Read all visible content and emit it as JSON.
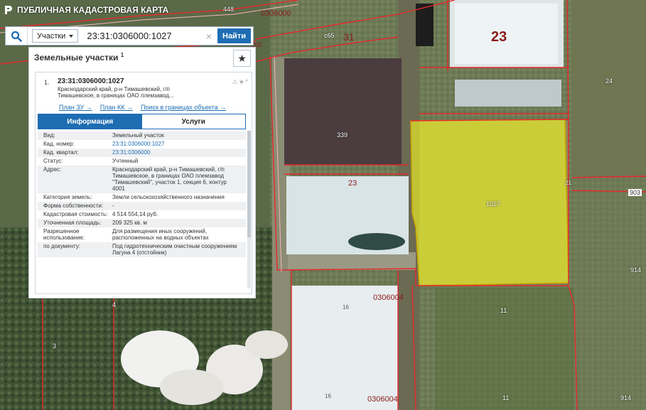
{
  "app": {
    "title": "ПУБЛИЧНАЯ КАДАСТРОВАЯ КАРТА"
  },
  "search": {
    "type_label": "Участки",
    "value": "23:31:0306000:1027",
    "submit_label": "Найти"
  },
  "panel": {
    "title": "Земельные участки",
    "count": "1",
    "item": {
      "index": "1.",
      "cad_number": "23:31:0306000:1027",
      "address_short": "Краснодарский край, р-н Тимашевский, г/п Тимашевское, в границах ОАО племзавод...",
      "links": [
        "План ЗУ →",
        "План КК →",
        "Поиск в границах объекта →"
      ],
      "tabs": [
        "Информация",
        "Услуги"
      ],
      "rows": [
        {
          "k": "Вид:",
          "v": "Земельный участок"
        },
        {
          "k": "Кад. номер:",
          "v": "23:31:0306000:1027"
        },
        {
          "k": "Кад. квартал:",
          "v": "23:31:0306000"
        },
        {
          "k": "Статус:",
          "v": "Учтенный"
        },
        {
          "k": "Адрес:",
          "v": "Краснодарский край, р-н Тимашевский, г/п Тимашевское, в границах ОАО племзавод \"Тимашевский\", участок 1, секция 6, контур 4001"
        },
        {
          "k": "Категория земель:",
          "v": "Земли сельскохозяйственного назначения"
        },
        {
          "k": "Форма собственности:",
          "v": "-"
        },
        {
          "k": "Кадастровая стоимость:",
          "v": "4 514 554,14 руб."
        },
        {
          "k": "Уточненная площадь:",
          "v": "209 325 кв. м"
        },
        {
          "k": "Разрешенное использование:",
          "v": "Для размещения иных сооружений, расположенных на водных объектах"
        },
        {
          "k": "по документу:",
          "v": "Под гидротехническим очистным сооружением Лагуна 4 (отстойник)"
        }
      ]
    }
  },
  "map_labels": {
    "l448": "448",
    "l0306000": "0306000",
    "lc65": "c65",
    "l31": "31",
    "l23big": "23",
    "l24": "24",
    "l339": "339",
    "l23a": "23",
    "l1027": "1027",
    "l903": "903",
    "l21": "21",
    "l914a": "914",
    "l11a": "11",
    "l16a": "16",
    "l0306004a": "0306004",
    "l3": "3",
    "l4": "4",
    "l2a": "2",
    "l2b": "2",
    "l16b": "16",
    "l0306004b": "0306004",
    "l11b": "11",
    "l914b": "914",
    "l200": "200"
  },
  "colors": {
    "accent": "#1e6db3",
    "parcel_highlight": "#e6ea2a",
    "boundary": "#e8282c"
  }
}
